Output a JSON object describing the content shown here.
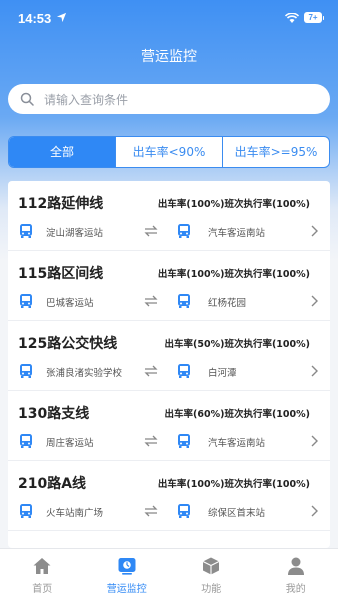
{
  "status_bar": {
    "time": "14:53",
    "battery": "7+"
  },
  "header": {
    "title": "营运监控"
  },
  "search": {
    "placeholder": "请输入查询条件"
  },
  "filter_tabs": [
    {
      "label": "全部",
      "active": true
    },
    {
      "label": "出车率<90%",
      "active": false
    },
    {
      "label": "出车率>=95%",
      "active": false
    }
  ],
  "routes": [
    {
      "name": "112路延伸线",
      "rates": "出车率(100%)班次执行率(100%)",
      "from": "淀山湖客运站",
      "to": "汽车客运南站"
    },
    {
      "name": "115路区间线",
      "rates": "出车率(100%)班次执行率(100%)",
      "from": "巴城客运站",
      "to": "红杨花园"
    },
    {
      "name": "125路公交快线",
      "rates": "出车率(50%)班次执行率(100%)",
      "from": "张浦良渚实验学校",
      "to": "白河潭"
    },
    {
      "name": "130路支线",
      "rates": "出车率(60%)班次执行率(100%)",
      "from": "周庄客运站",
      "to": "汽车客运南站"
    },
    {
      "name": "210路A线",
      "rates": "出车率(100%)班次执行率(100%)",
      "from": "火车站南广场",
      "to": "综保区首末站"
    }
  ],
  "tabbar": [
    {
      "label": "首页",
      "icon": "home-icon",
      "active": false
    },
    {
      "label": "营运监控",
      "icon": "monitor-icon",
      "active": true
    },
    {
      "label": "功能",
      "icon": "cube-icon",
      "active": false
    },
    {
      "label": "我的",
      "icon": "person-icon",
      "active": false
    }
  ],
  "colors": {
    "accent": "#2f88f5",
    "header_top": "#3f90f3",
    "bus_icon": "#2f88f5"
  }
}
